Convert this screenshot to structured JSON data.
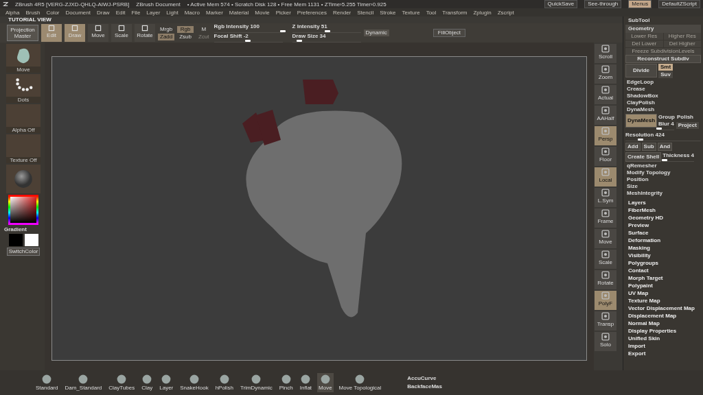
{
  "title_bar": {
    "app": "ZBrush 4R5 [VERG-ZJXD-QHLQ-AIWJ-PSRB]",
    "document": "ZBrush Document",
    "stats": "• Active Mem 574 • Scratch Disk 128 • Free Mem 1131 • ZTime›5.255 Timer›0.925",
    "buttons": [
      {
        "label": "QuickSave",
        "selected": false
      },
      {
        "label": "See-through",
        "selected": false
      },
      {
        "label": "Menus",
        "selected": true
      },
      {
        "label": "DefaultZScript",
        "selected": false
      }
    ]
  },
  "menu": [
    "Alpha",
    "Brush",
    "Color",
    "Document",
    "Draw",
    "Edit",
    "File",
    "Layer",
    "Light",
    "Macro",
    "Marker",
    "Material",
    "Movie",
    "Picker",
    "Preferences",
    "Render",
    "Stencil",
    "Stroke",
    "Texture",
    "Tool",
    "Transform",
    "Zplugin",
    "Zscript"
  ],
  "view_label": "TUTORIAL VIEW",
  "top_shelf": {
    "projection": "Projection Master",
    "modes": [
      {
        "label": "Edit",
        "selected": true
      },
      {
        "label": "Draw",
        "selected": true
      },
      {
        "label": "Move",
        "selected": false
      },
      {
        "label": "Scale",
        "selected": false
      },
      {
        "label": "Rotate",
        "selected": false
      }
    ],
    "toggles": [
      {
        "label": "Mrgb",
        "selected": false,
        "disabled": false
      },
      {
        "label": "Rgb",
        "selected": true,
        "disabled": false
      },
      {
        "label": "M",
        "selected": false,
        "disabled": false
      },
      {
        "label": "Zadd",
        "selected": true,
        "disabled": false
      },
      {
        "label": "Zsub",
        "selected": false,
        "disabled": false
      },
      {
        "label": "Zcut",
        "selected": false,
        "disabled": true
      }
    ],
    "sliders": [
      {
        "label": "Rgb Intensity 100",
        "level": 1.0
      },
      {
        "label": "Z Intensity 51",
        "level": 0.51
      },
      {
        "label": "Focal Shift -2",
        "level": 0.49
      },
      {
        "label": "Draw Size 34",
        "level": 0.1
      }
    ],
    "dynamic": "Dynamic",
    "fill_object": "FillObject"
  },
  "left_shelf": {
    "tiles": [
      {
        "kind": "brush",
        "label": "Move"
      },
      {
        "kind": "stroke",
        "label": "Dots"
      },
      {
        "kind": "empty",
        "label": "Alpha Off"
      },
      {
        "kind": "empty",
        "label": "Texture Off"
      },
      {
        "kind": "material"
      }
    ],
    "gradient": "Gradient",
    "switch_color": "SwitchColor"
  },
  "view_tools": [
    {
      "label": "Scroll",
      "selected": false
    },
    {
      "label": "Zoom",
      "selected": false
    },
    {
      "label": "Actual",
      "selected": false
    },
    {
      "label": "AAHalf",
      "selected": false
    },
    {
      "label": "Persp",
      "selected": true
    },
    {
      "label": "Floor",
      "selected": false
    },
    {
      "label": "Local",
      "selected": true
    },
    {
      "label": "L.Sym",
      "selected": false
    },
    {
      "label": "Frame",
      "selected": false
    },
    {
      "label": "Move",
      "selected": false
    },
    {
      "label": "Scale",
      "selected": false
    },
    {
      "label": "Rotate",
      "selected": false
    },
    {
      "label": "PolyF",
      "selected": true
    },
    {
      "label": "Transp",
      "selected": false
    },
    {
      "label": "Solo",
      "selected": false
    }
  ],
  "tool_panel": {
    "subtool": "SubTool",
    "geometry": "Geometry",
    "faded": [
      "Lower Res",
      "Higher Res",
      "Del Lower",
      "Del Higher",
      "Freeze SubdivisionLevels"
    ],
    "reconstruct": "Reconstruct Subdiv",
    "divide": "Divide",
    "divide_options": [
      {
        "label": "Smt",
        "selected": true
      },
      {
        "label": "Suv",
        "selected": false
      }
    ],
    "geometry_items": [
      "EdgeLoop",
      "Crease",
      "ShadowBox",
      "ClayPolish",
      "DynaMesh"
    ],
    "dynamesh": {
      "button": "DynaMesh",
      "group": "Group",
      "polish": "Polish",
      "blur": {
        "label": "Blur 4",
        "level": 0.05
      },
      "project": "Project",
      "resolution": {
        "label": "Resolution 424",
        "level": 0.2
      },
      "ops": [
        "Add",
        "Sub",
        "And"
      ],
      "create_shell": "Create Shell",
      "thickness": {
        "label": "Thickness 4",
        "level": 0.05
      }
    },
    "more_items": [
      "qRemesher",
      "Modify Topology",
      "Position",
      "Size",
      "MeshIntegrity"
    ],
    "sections": [
      "Layers",
      "FiberMesh",
      "Geometry HD",
      "Preview",
      "Surface",
      "Deformation",
      "Masking",
      "Visibility",
      "Polygroups",
      "Contact",
      "Morph Target",
      "Polypaint",
      "UV Map",
      "Texture Map",
      "Vector Displacement Map",
      "Displacement Map",
      "Normal Map",
      "Display Properties",
      "Unified Skin",
      "Import",
      "Export"
    ]
  },
  "brushes": [
    {
      "label": "Standard",
      "selected": false
    },
    {
      "label": "Dam_Standard",
      "selected": false
    },
    {
      "label": "ClayTubes",
      "selected": false
    },
    {
      "label": "Clay",
      "selected": false
    },
    {
      "label": "Layer",
      "selected": false
    },
    {
      "label": "SnakeHook",
      "selected": false
    },
    {
      "label": "hPolish",
      "selected": false
    },
    {
      "label": "TrimDynamic",
      "selected": false
    },
    {
      "label": "Pinch",
      "selected": false
    },
    {
      "label": "Inflat",
      "selected": false
    },
    {
      "label": "Move",
      "selected": true
    },
    {
      "label": "Move Topological",
      "selected": false
    }
  ],
  "bottom_options": [
    "AccuCurve",
    "BackfaceMas"
  ]
}
